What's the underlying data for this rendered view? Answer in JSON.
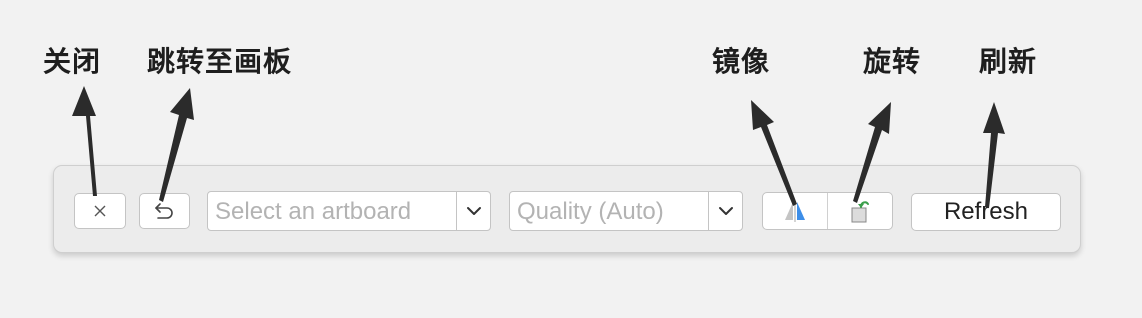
{
  "annotations": {
    "close": "关闭",
    "jump": "跳转至画板",
    "mirror": "镜像",
    "rotate": "旋转",
    "refresh": "刷新"
  },
  "toolbar": {
    "artboard_placeholder": "Select an artboard",
    "quality_placeholder": "Quality (Auto)",
    "refresh_label": "Refresh"
  },
  "icons": {
    "close": "close-icon",
    "back": "undo-arrow-icon",
    "mirror": "mirror-triangle-icon",
    "rotate": "rotate-square-icon",
    "chevron": "chevron-down-icon"
  },
  "colors": {
    "mirror_accent": "#3d8ee8",
    "rotate_accent": "#3a9e4a",
    "arrow": "#2b2b2b"
  }
}
